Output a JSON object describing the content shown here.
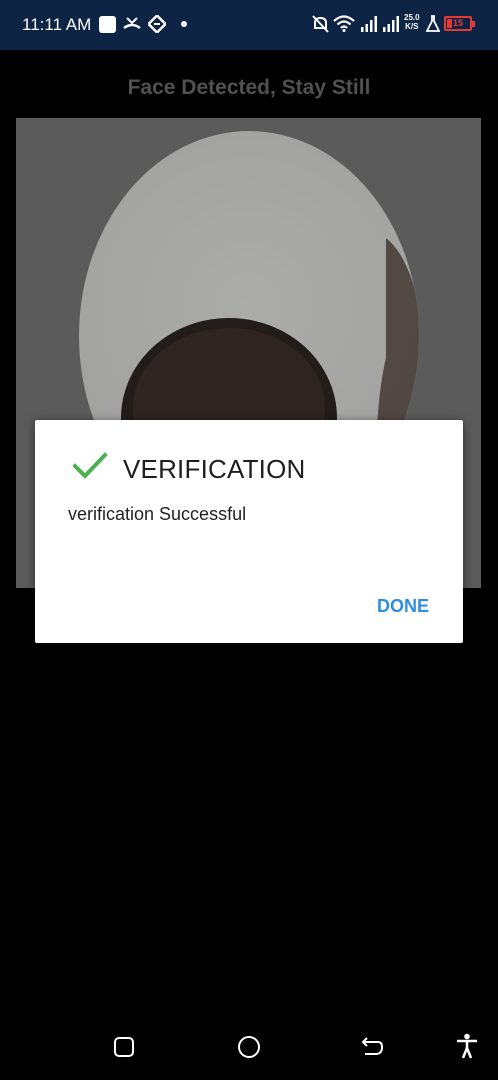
{
  "status_bar": {
    "time": "11:11 AM",
    "network_speed_value": "25.0",
    "network_speed_unit": "K/S",
    "battery_level": "15",
    "icons": [
      "app-notification-icon",
      "missed-call-icon",
      "app-icon",
      "dot-icon",
      "silent-mode-icon",
      "wifi-icon",
      "signal-icon",
      "signal-icon",
      "flask-icon",
      "battery-icon"
    ]
  },
  "camera": {
    "title": "Face Detected, Stay Still"
  },
  "dialog": {
    "title": "VERIFICATION",
    "message": "verification Successful",
    "done_label": "DONE",
    "check_color": "#4caf50",
    "button_color": "#2f8ee0"
  },
  "nav_bar": {
    "buttons": [
      "recent-apps-icon",
      "home-icon",
      "back-icon",
      "accessibility-icon"
    ]
  }
}
